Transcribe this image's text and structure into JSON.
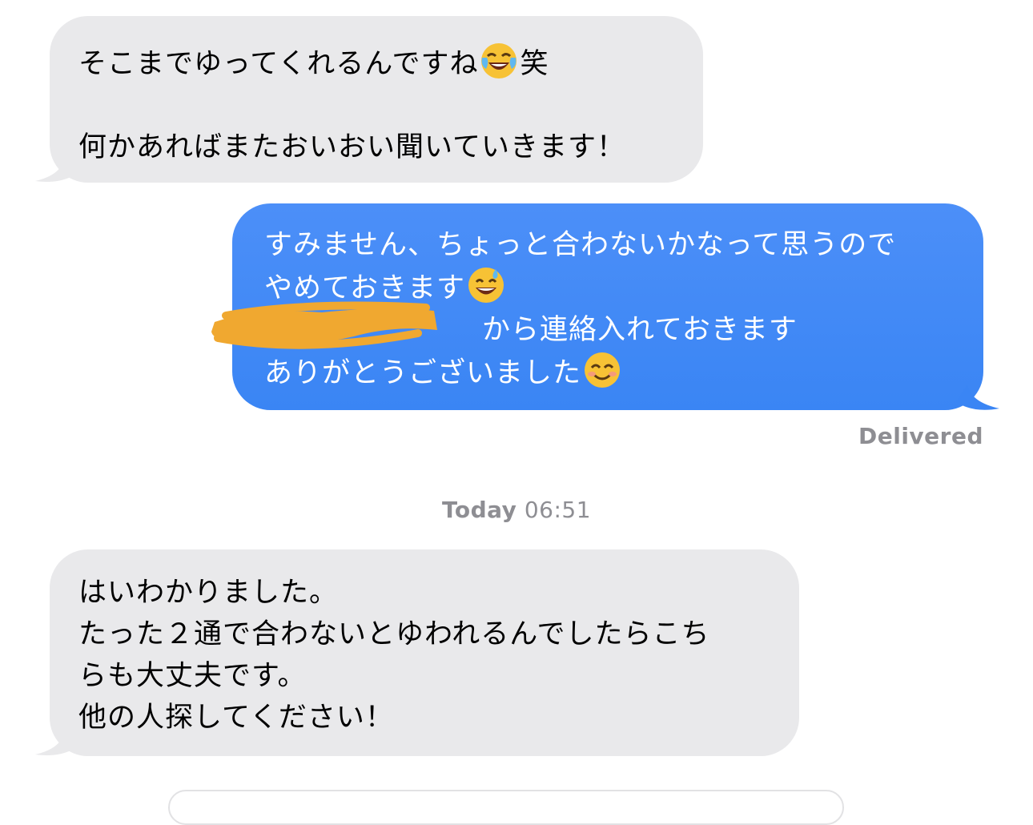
{
  "conversation": {
    "messages": [
      {
        "direction": "incoming",
        "lines": [
          "そこまでゆってくれるんですね",
          "笑",
          "",
          "何かあればまたおいおい聞いていきます！"
        ],
        "emoji": "face-with-tears-of-joy-icon"
      },
      {
        "direction": "outgoing",
        "lines": [
          "すみません、ちょっと合わないかなって思うので",
          "やめておきます",
          "から連絡入れておきます",
          "ありがとうございました"
        ],
        "emoji": [
          "grinning-face-with-sweat-icon",
          "smiling-face-with-smiling-eyes-icon"
        ],
        "redacted_prefix": true
      },
      {
        "direction": "incoming",
        "lines": [
          "はいわかりました。",
          "たった２通で合わないとゆわれるんでしたらこち",
          "らも大丈夫です。",
          "他の人探してください！"
        ]
      }
    ],
    "delivered_label": "Delivered",
    "timestamp_day": "Today",
    "timestamp_time": "06:51"
  },
  "colors": {
    "incoming_bubble": "#e9e9eb",
    "outgoing_bubble": "#3b86f5",
    "meta_text": "#8e8e93",
    "redaction": "#f0a830"
  }
}
